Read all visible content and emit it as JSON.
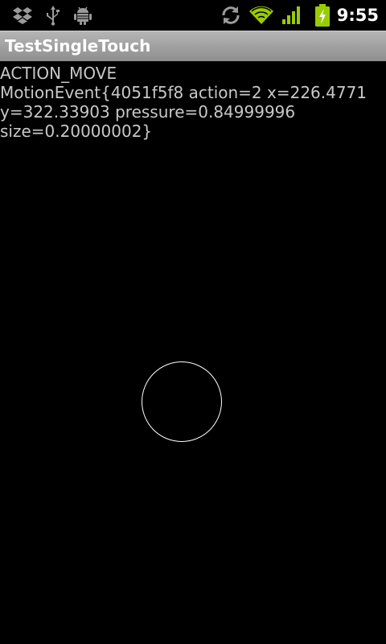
{
  "status_bar": {
    "icons": [
      "dropbox-icon",
      "usb-icon",
      "android-debug-icon",
      "sync-icon",
      "wifi-icon",
      "signal-icon",
      "battery-charging-icon"
    ],
    "time": "9:55",
    "accent_color": "#99cc00"
  },
  "app": {
    "title": "TestSingleTouch"
  },
  "event": {
    "action_name": "ACTION_MOVE",
    "details": "MotionEvent{4051f5f8 action=2 x=226.4771 y=322.33903 pressure=0.84999996 size=0.20000002}"
  }
}
